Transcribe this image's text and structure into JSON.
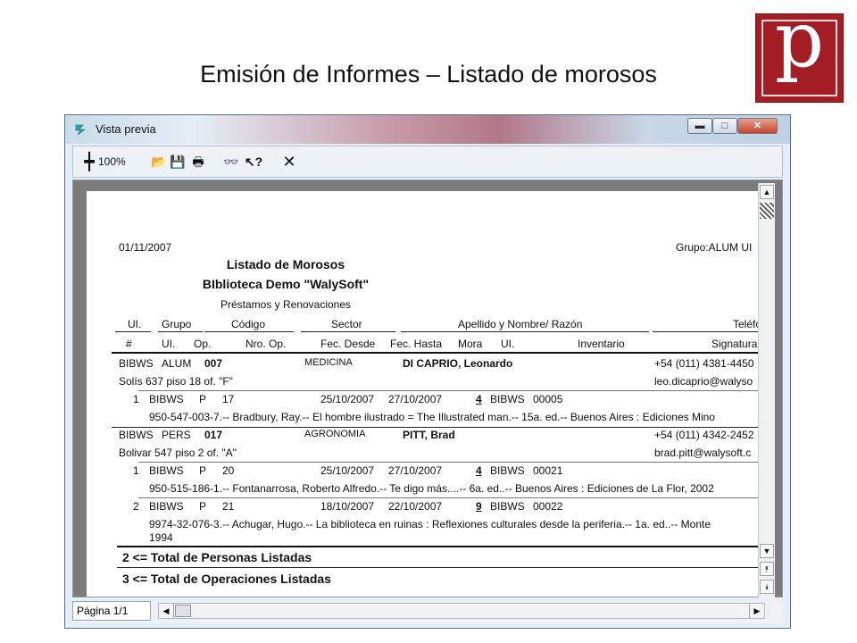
{
  "slide": {
    "title": "Emisión de Informes – Listado de morosos"
  },
  "logo": {
    "letter": "p",
    "color": "#a31d24"
  },
  "window": {
    "title": "Vista previa",
    "controls": {
      "minimize": "▬",
      "maximize": "□",
      "close": "✕"
    },
    "toolbar": {
      "zoom_icon": "┿",
      "zoom_value": "100%",
      "open_icon": "📂",
      "save_icon": "💾",
      "print_icon": "🖶",
      "find_icon": "👓",
      "help_icon": "↖?",
      "close_icon": "✕"
    },
    "status": {
      "page": "Página 1/1"
    },
    "scroll": {
      "up": "▲",
      "down": "▼",
      "pgup": "⯭",
      "pgdn": "⯯",
      "left": "◀",
      "right": "▶"
    }
  },
  "report": {
    "date": "01/11/2007",
    "group_header": "Grupo:ALUM  UI",
    "title": "Listado de Morosos",
    "library": "BIblioteca Demo \"WalySoft\"",
    "subtitle": "Préstamos y Renovaciones",
    "header1": {
      "ui": "UI.",
      "grupo": "Grupo",
      "codigo": "Código",
      "sector": "Sector",
      "apellido": "Apellido y Nombre/ Razón",
      "telefono": "Teléfo"
    },
    "header2": {
      "num": "#",
      "ui": "UI.",
      "op": "Op.",
      "nro_op": "Nro. Op.",
      "fec_desde": "Fec. Desde",
      "fec_hasta": "Fec. Hasta",
      "mora": "Mora",
      "ui2": "UI.",
      "inventario": "Inventario",
      "signatura": "Signatura T"
    },
    "persons": [
      {
        "ui": "BIBWS",
        "grupo": "ALUM",
        "codigo": "007",
        "sector": "MEDICINA",
        "nombre": "DI CAPRIO, Leonardo",
        "telefono": "+54 (011) 4381-4450",
        "direccion": "Solís 637 piso 18 of. \"F\"",
        "email": "leo.dicaprio@walyso",
        "ops": [
          {
            "num": "1",
            "ui": "BIBWS",
            "op": "P",
            "nro": "17",
            "desde": "25/10/2007",
            "hasta": "27/10/2007",
            "mora": "4",
            "ui2": "BIBWS",
            "inv": "00005",
            "desc": "950-547-003-7.-- Bradbury, Ray.-- El hombre ilustrado = The Illustrated man.-- 15a. ed.-- Buenos Aires : Ediciones Mino",
            "desc2": ""
          }
        ]
      },
      {
        "ui": "BIBWS",
        "grupo": "PERS",
        "codigo": "017",
        "sector": "AGRONOMIA",
        "nombre": "PITT, Brad",
        "telefono": "+54 (011) 4342-2452",
        "direccion": "Bolivar 547 piso 2 of. \"A\"",
        "email": "brad.pitt@walysoft.c",
        "ops": [
          {
            "num": "1",
            "ui": "BIBWS",
            "op": "P",
            "nro": "20",
            "desde": "25/10/2007",
            "hasta": "27/10/2007",
            "mora": "4",
            "ui2": "BIBWS",
            "inv": "00021",
            "desc": "950-515-186-1.-- Fontanarrosa, Roberto Alfredo.-- Te digo más....-- 6a. ed..-- Buenos Aires : Ediciones de La Flor, 2002",
            "desc2": ""
          },
          {
            "num": "2",
            "ui": "BIBWS",
            "op": "P",
            "nro": "21",
            "desde": "18/10/2007",
            "hasta": "22/10/2007",
            "mora": "9",
            "ui2": "BIBWS",
            "inv": "00022",
            "desc": "9974-32-076-3.-- Achugar, Hugo.-- La biblioteca en ruinas : Reflexiones culturales desde la periferia.-- 1a. ed..-- Monte",
            "desc2": "1994"
          }
        ]
      }
    ],
    "totals": {
      "personas": "2 <= Total de Personas Listadas",
      "operaciones": "3 <= Total de Operaciones Listadas"
    }
  }
}
